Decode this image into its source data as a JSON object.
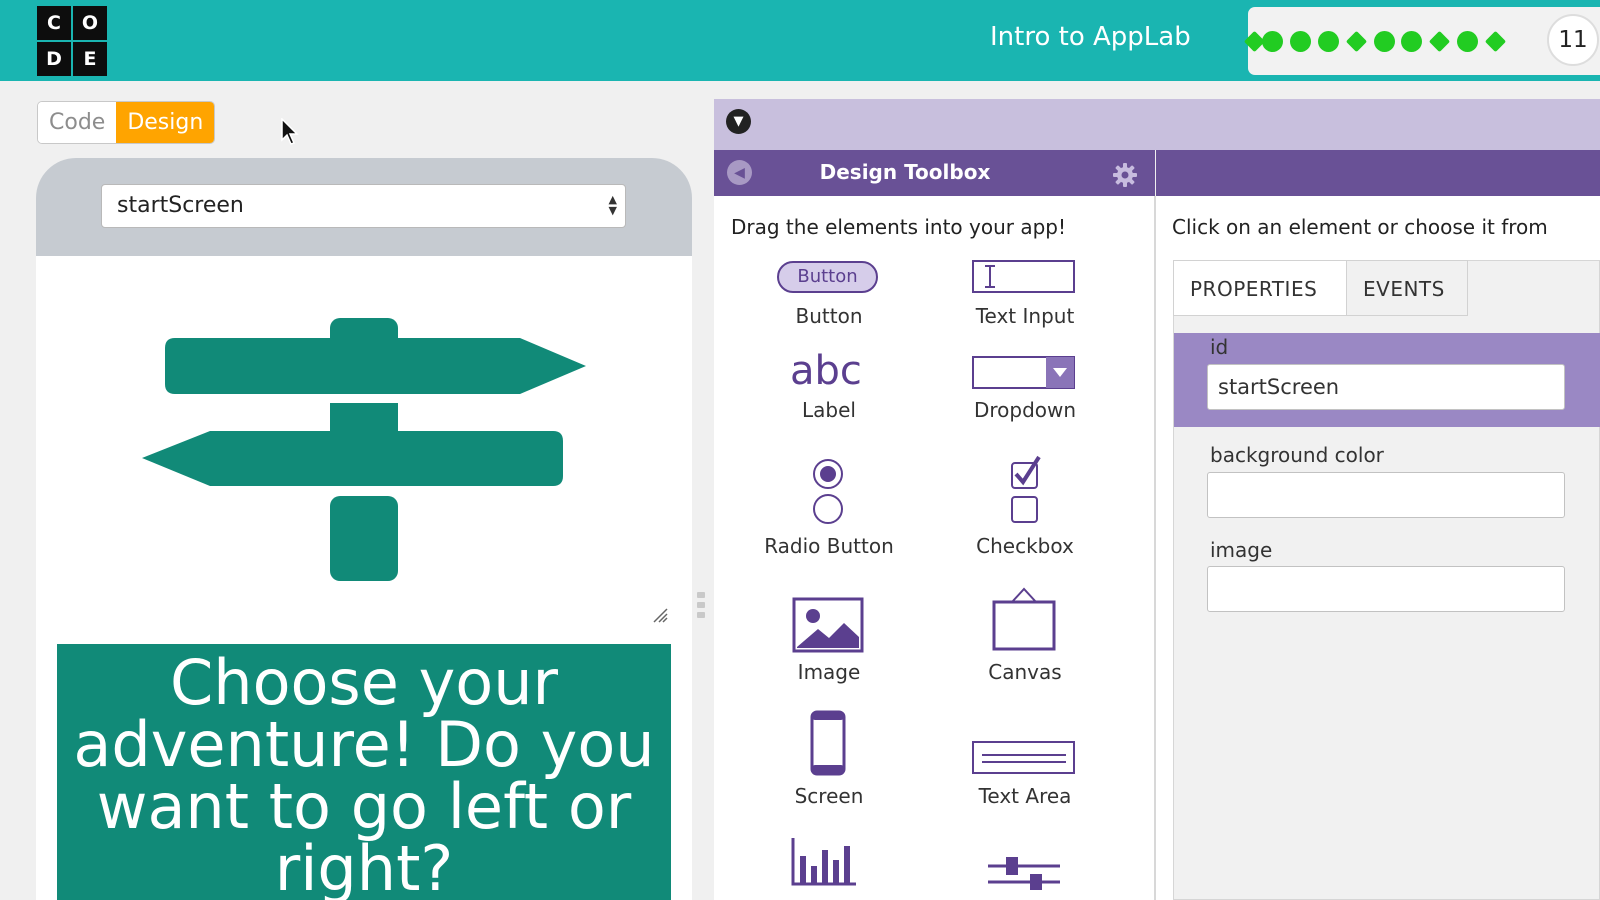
{
  "header": {
    "logo_letters": [
      "C",
      "O",
      "D",
      "E"
    ],
    "lesson_title": "Intro to AppLab",
    "level_number": "11",
    "progress_level_count": 10,
    "progress_color": "#22cc22"
  },
  "mode_toggle": {
    "code_label": "Code",
    "design_label": "Design",
    "active": "Design"
  },
  "app_preview": {
    "screen_select_value": "startScreen",
    "text_block": "Choose your adventure! Do you want to go left or right?",
    "image_fill_color": "#118a78",
    "text_block_bg": "#118a78"
  },
  "toolbox": {
    "title": "Design Toolbox",
    "instruction": "Drag the elements into your app!",
    "button_icon_text": "Button",
    "label_icon_text": "abc",
    "items": [
      {
        "label": "Button",
        "icon": "button-icon"
      },
      {
        "label": "Text Input",
        "icon": "text-input-icon"
      },
      {
        "label": "Label",
        "icon": "label-icon"
      },
      {
        "label": "Dropdown",
        "icon": "dropdown-icon"
      },
      {
        "label": "Radio Button",
        "icon": "radio-button-icon"
      },
      {
        "label": "Checkbox",
        "icon": "checkbox-icon"
      },
      {
        "label": "Image",
        "icon": "image-icon"
      },
      {
        "label": "Canvas",
        "icon": "canvas-icon"
      },
      {
        "label": "Screen",
        "icon": "screen-icon"
      },
      {
        "label": "Text Area",
        "icon": "text-area-icon"
      },
      {
        "label": "",
        "icon": "chart-icon"
      },
      {
        "label": "",
        "icon": "slider-icon"
      }
    ]
  },
  "properties": {
    "instruction": "Click on an element or choose it from",
    "tabs": [
      "PROPERTIES",
      "EVENTS"
    ],
    "fields": [
      {
        "label": "id",
        "value": "startScreen"
      },
      {
        "label": "background color",
        "value": ""
      },
      {
        "label": "image",
        "value": ""
      }
    ]
  },
  "colors": {
    "header_teal": "#1ab5b1",
    "design_orange": "#ffa400",
    "toolbox_purple": "#695196",
    "icon_purple": "#5b3f8f"
  }
}
